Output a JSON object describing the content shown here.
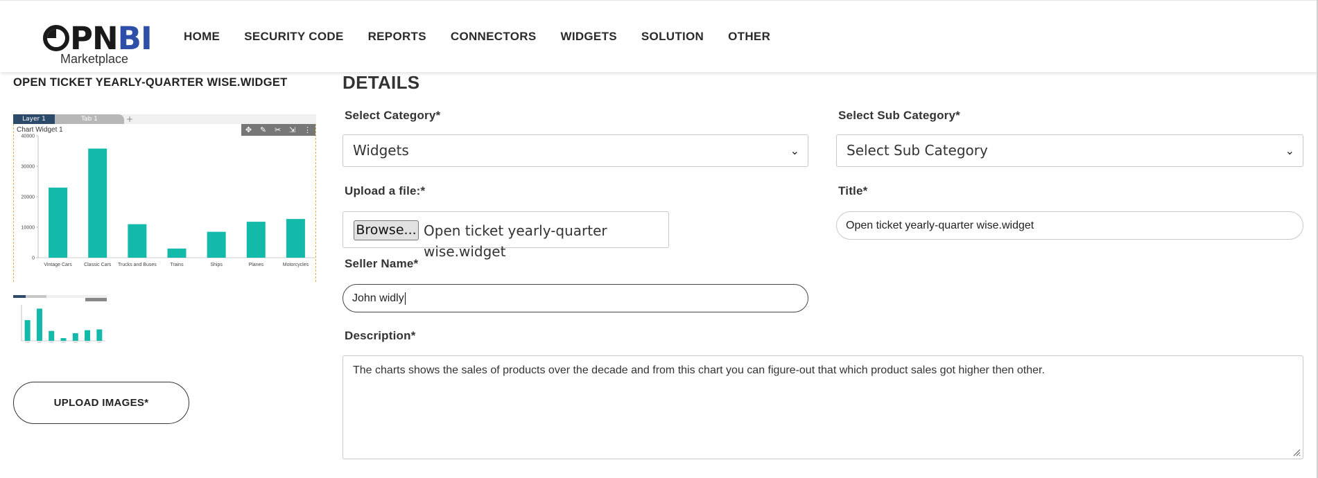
{
  "brand": {
    "logo_pn": "PN",
    "logo_bi": "BI",
    "subtitle": "Marketplace"
  },
  "nav": [
    "HOME",
    "SECURITY CODE",
    "REPORTS",
    "CONNECTORS",
    "WIDGETS",
    "SOLUTION",
    "OTHER"
  ],
  "widget": {
    "title": "OPEN TICKET YEARLY-QUARTER WISE.WIDGET",
    "layer_tab": "Layer 1",
    "tab_name": "Tab 1",
    "add_tab": "+",
    "chart_title": "Chart Widget 1",
    "upload_images_label": "UPLOAD IMAGES*"
  },
  "chart_data": {
    "type": "bar",
    "title": "Chart Widget 1",
    "categories": [
      "Vintage Cars",
      "Classic Cars",
      "Trucks and Buses",
      "Trains",
      "Ships",
      "Planes",
      "Motorcycles"
    ],
    "values": [
      23000,
      35800,
      11000,
      3000,
      8500,
      11800,
      12700
    ],
    "yticks": [
      0,
      10000,
      20000,
      30000,
      40000
    ],
    "ylim": [
      0,
      40000
    ],
    "color": "#13b9a9"
  },
  "form": {
    "heading": "DETAILS",
    "category_label": "Select Category*",
    "category_value": "Widgets",
    "subcategory_label": "Select Sub Category*",
    "subcategory_value": "Select Sub Category",
    "upload_label": "Upload a file:*",
    "browse_label": "Browse...",
    "file_name": "Open ticket yearly-quarter wise.widget",
    "title_label": "Title*",
    "title_value": "Open ticket yearly-quarter wise.widget",
    "seller_label": "Seller Name*",
    "seller_value": "John widly",
    "description_label": "Description*",
    "description_value": "The charts shows the sales of products over the decade and from this chart you can figure-out that which product sales got higher then other."
  },
  "colors": {
    "accent": "#2e4fa7",
    "bar": "#13b9a9",
    "tab_active": "#2d4a6a"
  }
}
